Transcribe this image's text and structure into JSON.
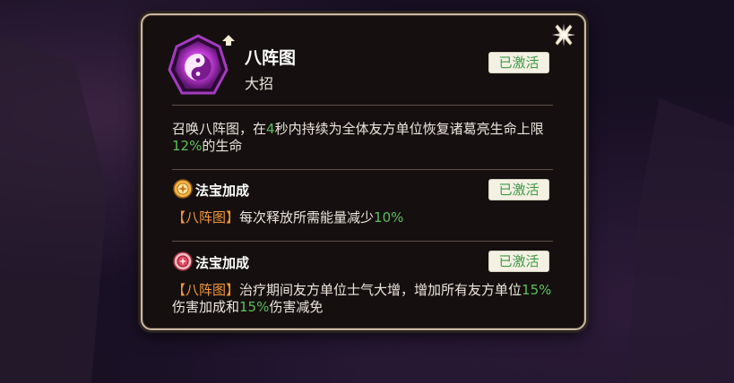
{
  "skill": {
    "name": "八阵图",
    "type": "大招",
    "status": "已激活",
    "description": {
      "p1": "召唤八阵图，在",
      "v1": "4",
      "p2": "秒内持续为全体友方单位恢复诸葛亮生命上限",
      "v2": "12%",
      "p3": "的生命"
    }
  },
  "bonuses": [
    {
      "title": "法宝加成",
      "status": "已激活",
      "tag": "【八阵图】",
      "t1": "每次释放所需能量减少",
      "v1": "10%",
      "icon": "gold-treasure-icon"
    },
    {
      "title": "法宝加成",
      "status": "已激活",
      "tag": "【八阵图】",
      "t1": "治疗期间友方单位士气大增，增加所有友方单位",
      "v1": "15%",
      "t2": "伤害加成和",
      "v2": "15%",
      "t3": "伤害减免",
      "icon": "red-treasure-icon"
    }
  ],
  "colors": {
    "highlight": "#5fbf5c",
    "tag": "#f2963a",
    "badge_text": "#3f9a45",
    "panel_border": "#cbb9a2"
  },
  "icons": {
    "skill": "yin-yang-icon",
    "upgrade": "upgrade-arrow-icon",
    "close": "close-icon"
  }
}
